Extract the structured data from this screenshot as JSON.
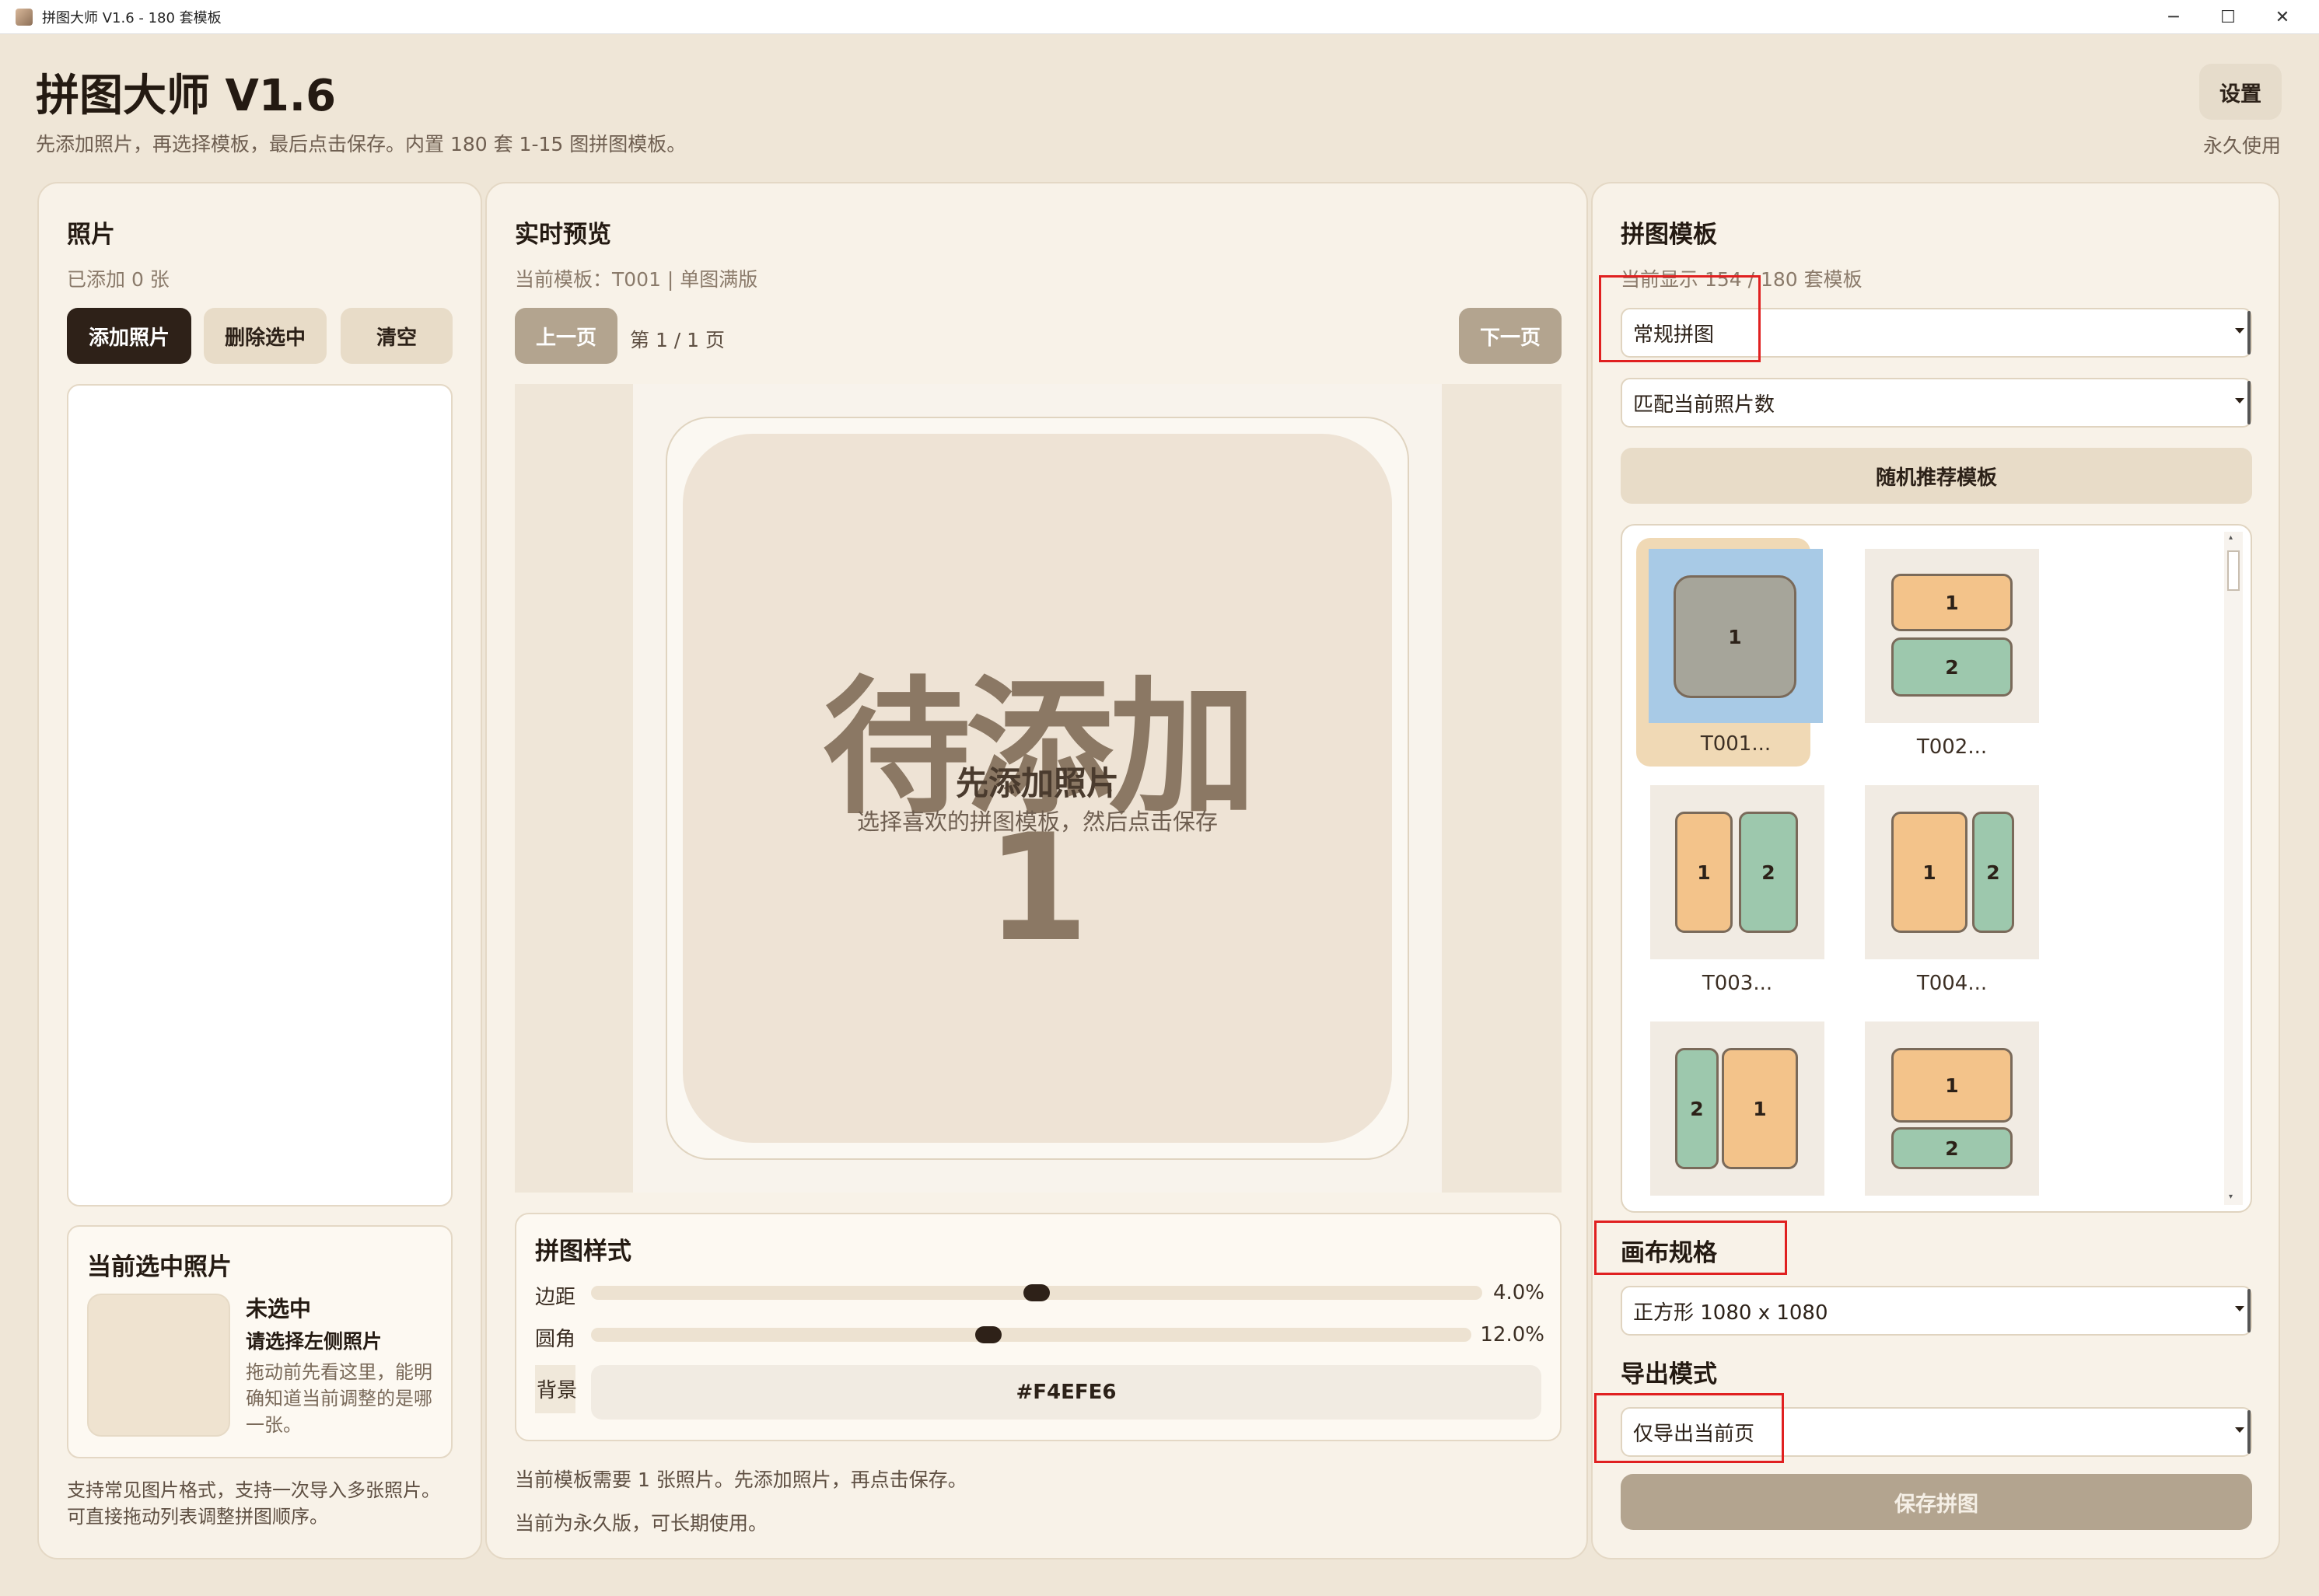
{
  "window": {
    "title": "拼图大师 V1.6 - 180 套模板",
    "controls": {
      "minimize": "─",
      "maximize": "☐",
      "close": "✕"
    }
  },
  "header": {
    "title": "拼图大师 V1.6",
    "subtitle": "先添加照片，再选择模板，最后点击保存。内置 180 套 1-15 图拼图模板。",
    "settings_label": "设置",
    "license_label": "永久使用"
  },
  "photos": {
    "heading": "照片",
    "count_text": "已添加 0 张",
    "add_label": "添加照片",
    "delete_label": "删除选中",
    "clear_label": "清空",
    "selected_heading": "当前选中照片",
    "selected_title": "未选中",
    "selected_hint": "请选择左侧照片",
    "selected_desc": "拖动前先看这里，能明确知道当前调整的是哪一张。",
    "footer_note": "支持常见图片格式，支持一次导入多张照片。可直接拖动列表调整拼图顺序。"
  },
  "preview": {
    "heading": "实时预览",
    "current_template": "当前模板：T001 | 单图满版",
    "prev_label": "上一页",
    "page_text": "第 1 / 1 页",
    "next_label": "下一页",
    "placeholder_big": "待添加",
    "placeholder_num": "1",
    "placeholder_title": "先添加照片",
    "placeholder_sub": "选择喜欢的拼图模板，然后点击保存",
    "style_heading": "拼图样式",
    "margin_label": "边距",
    "margin_value": "4.0%",
    "margin_fraction": 0.5,
    "radius_label": "圆角",
    "radius_value": "12.0%",
    "radius_fraction": 0.45,
    "bg_label": "背景",
    "bg_value": "#F4EFE6",
    "status_note": "当前模板需要 1 张照片。先添加照片，再点击保存。",
    "license_note": "当前为永久版，可长期使用。"
  },
  "templates": {
    "heading": "拼图模板",
    "count_text": "当前显示 154 / 180 套模板",
    "category_value": "常规拼图",
    "filter_value": "匹配当前照片数",
    "random_label": "随机推荐模板",
    "items": [
      {
        "name": "T001...",
        "cells": [
          "1"
        ]
      },
      {
        "name": "T002...",
        "cells": [
          "1",
          "2"
        ]
      },
      {
        "name": "T003...",
        "cells": [
          "1",
          "2"
        ]
      },
      {
        "name": "T004...",
        "cells": [
          "1",
          "2"
        ]
      },
      {
        "name": "",
        "cells": [
          "2",
          "1"
        ]
      },
      {
        "name": "",
        "cells": [
          "1",
          "2"
        ]
      }
    ],
    "canvas_heading": "画布规格",
    "canvas_value": "正方形 1080 x 1080",
    "export_heading": "导出模式",
    "export_value": "仅导出当前页",
    "save_label": "保存拼图"
  },
  "colors": {
    "accent_dark": "#2E2118",
    "cell_orange": "#F3C38A",
    "cell_green": "#9DC8AD",
    "cell_gray": "#A6A59A",
    "selected_bg": "#A8CAE6",
    "highlight_red": "#E02020"
  }
}
